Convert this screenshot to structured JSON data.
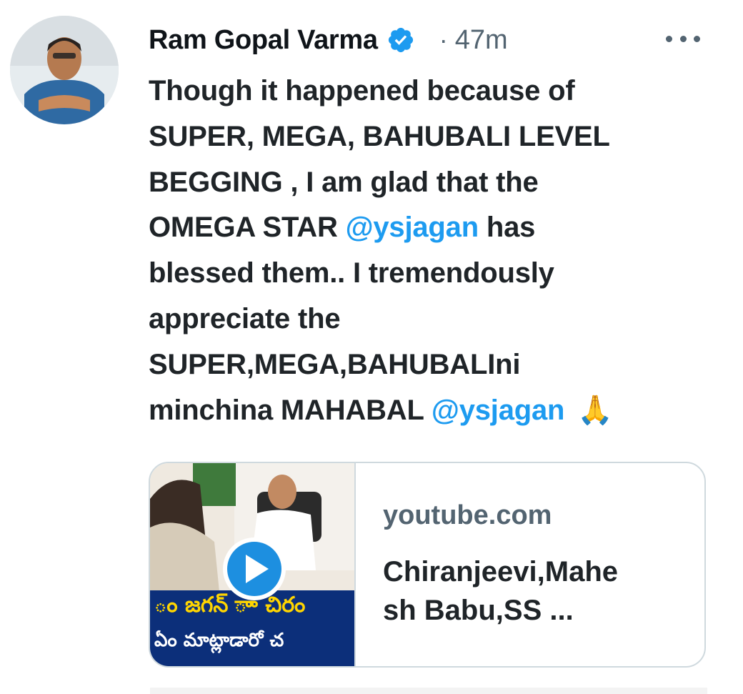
{
  "author": {
    "name": "Ram Gopal Varma",
    "verified": true,
    "dot": "·",
    "time": "47m"
  },
  "icons": {
    "avatar": "profile-photo",
    "verified": "verified-badge-icon",
    "more": "more-options-icon",
    "play": "play-icon",
    "emoji": "folded-hands-emoji"
  },
  "tweet": {
    "lines": [
      [
        {
          "text": "Though it happened because of",
          "type": "text"
        }
      ],
      [
        {
          "text": "SUPER, MEGA, BAHUBALI LEVEL",
          "type": "text"
        }
      ],
      [
        {
          "text": "BEGGING , I am glad that the",
          "type": "text"
        }
      ],
      [
        {
          "text": "OMEGA STAR  ",
          "type": "text"
        },
        {
          "text": "@ysjagan",
          "type": "mention"
        },
        {
          "text": " has",
          "type": "text"
        }
      ],
      [
        {
          "text": "blessed them.. I tremendously",
          "type": "text"
        }
      ],
      [
        {
          "text": "appreciate the",
          "type": "text"
        }
      ],
      [
        {
          "text": "SUPER,MEGA,BAHUBALIni",
          "type": "text"
        }
      ],
      [
        {
          "text": "minchina MAHABAL ",
          "type": "text"
        },
        {
          "text": "@ysjagan",
          "type": "mention"
        }
      ]
    ],
    "emoji": "🙏"
  },
  "card": {
    "domain": "youtube.com",
    "title": "Chiranjeevi,Mahe\nsh Babu,SS ...",
    "thumb_caption_1": "ం జగన్ ాా చిరం",
    "thumb_caption_2": "ఏం మాట్లాడారో చ"
  },
  "colors": {
    "link": "#1d9bf0",
    "verified": "#1d9bf0",
    "secondary": "#536471",
    "play": "#1d8fe0"
  }
}
